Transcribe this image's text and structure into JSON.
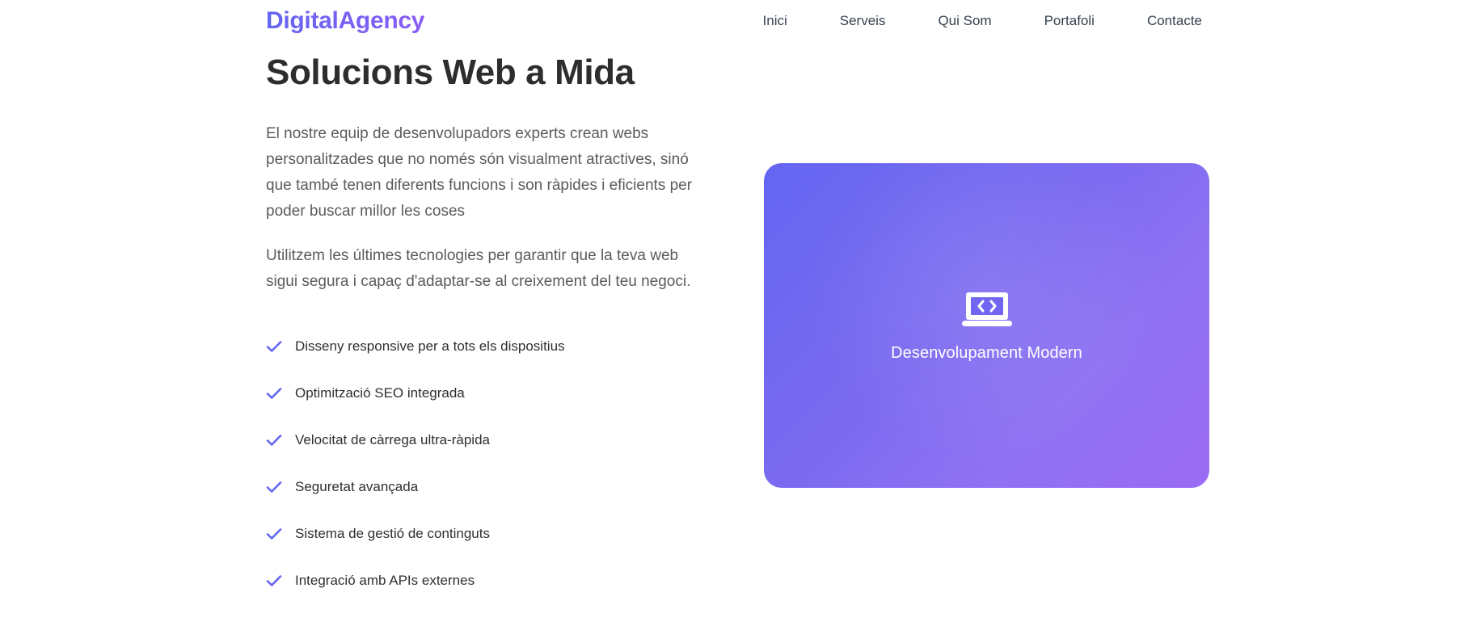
{
  "header": {
    "logo": "DigitalAgency",
    "nav": [
      "Inici",
      "Serveis",
      "Qui Som",
      "Portafoli",
      "Contacte"
    ]
  },
  "main": {
    "title": "Solucions Web a Mida",
    "paragraphs": [
      "El nostre equip de desenvolupadors experts crean webs personalitzades que no només són visualment atractives, sinó que també tenen diferents funcions i son ràpides i eficients per poder buscar millor les coses",
      "Utilitzem les últimes tecnologies per garantir que la teva web sigui segura i capaç d'adaptar-se al creixement del teu negoci."
    ],
    "features": [
      "Disseny responsive per a tots els dispositius",
      "Optimització SEO integrada",
      "Velocitat de càrrega ultra-ràpida",
      "Seguretat avançada",
      "Sistema de gestió de continguts",
      "Integració amb APIs externes"
    ]
  },
  "card": {
    "icon": "laptop-code-icon",
    "caption": "Desenvolupament Modern"
  },
  "colors": {
    "accent": "#6366f1",
    "accent_secondary": "#8b5cf6",
    "check": "#6366f1"
  }
}
